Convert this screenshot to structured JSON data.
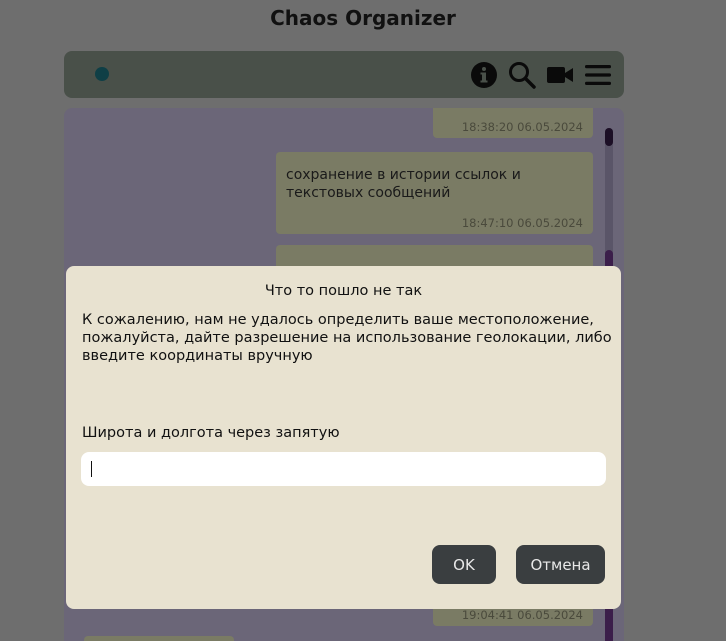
{
  "app": {
    "title": "Chaos Organizer"
  },
  "toolbar": {
    "icons": [
      "info-icon",
      "search-icon",
      "video-icon",
      "menu-icon"
    ],
    "status_color": "#0f3f46"
  },
  "messages": [
    {
      "text": "",
      "time": "18:38:20 06.05.2024"
    },
    {
      "text": "сохранение в истории ссылок и текстовых сообщений",
      "time": "18:47:10 06.05.2024"
    },
    {
      "text": "",
      "time": ""
    },
    {
      "text": "",
      "time": "19:04:41 06.05.2024"
    }
  ],
  "modal": {
    "title": "Что то пошло не так",
    "message": "К сожалению, нам не удалось определить ваше местоположение, пожалуйста, дайте разрешение на использование геолокации, либо введите координаты вручную",
    "field_label": "Широта и долгота через запятую",
    "input_value": "",
    "input_placeholder": "",
    "ok_label": "OK",
    "cancel_label": "Отмена"
  },
  "colors": {
    "modal_bg": "#e8e2d0",
    "button_bg": "#3a3e40",
    "accent_purple": "#3b1e4a"
  }
}
